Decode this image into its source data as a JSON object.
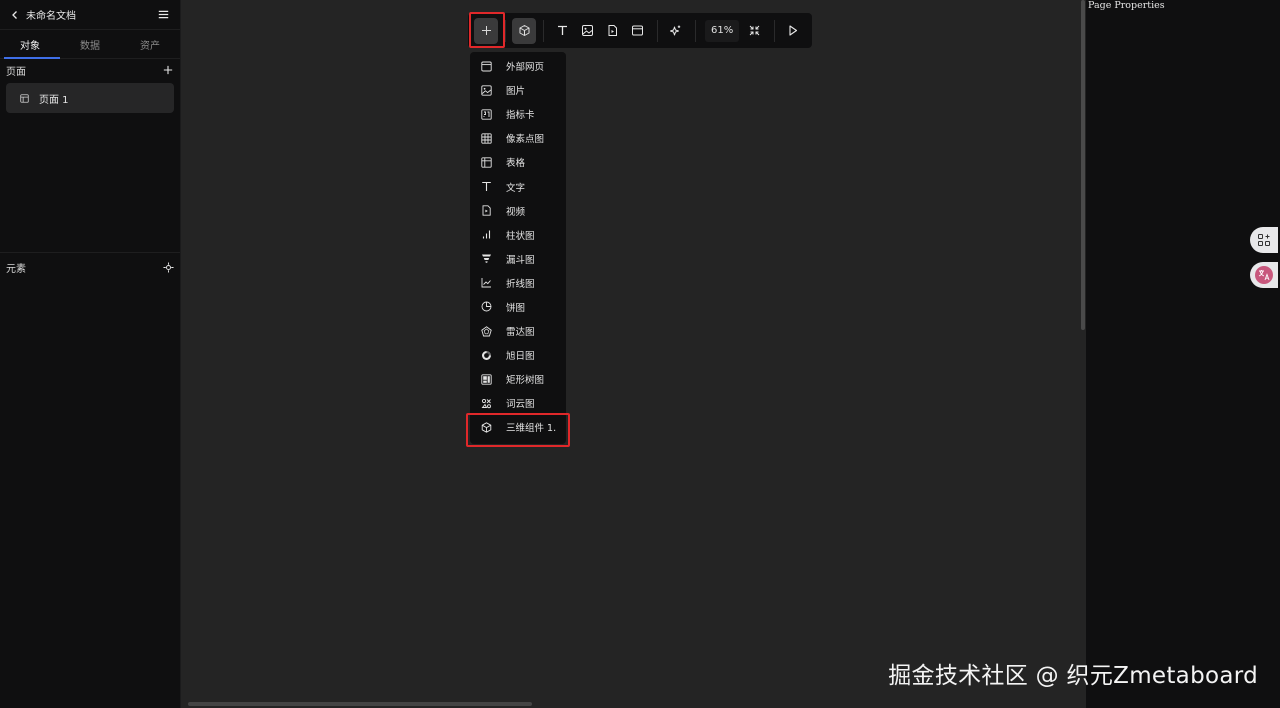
{
  "sidebar": {
    "doc_title": "未命名文档",
    "tabs": [
      {
        "label": "对象",
        "active": true
      },
      {
        "label": "数据",
        "active": false
      },
      {
        "label": "资产",
        "active": false
      }
    ],
    "pages_section": "页面",
    "pages": [
      {
        "label": "页面 1"
      }
    ],
    "elements_section": "元素"
  },
  "toolbar": {
    "zoom": "61%"
  },
  "dropdown": {
    "items": [
      {
        "label": "外部网页",
        "icon": "browser-window-icon"
      },
      {
        "label": "图片",
        "icon": "image-icon"
      },
      {
        "label": "指标卡",
        "icon": "metric-card-icon"
      },
      {
        "label": "像素点图",
        "icon": "grid-icon"
      },
      {
        "label": "表格",
        "icon": "table-icon"
      },
      {
        "label": "文字",
        "icon": "text-icon"
      },
      {
        "label": "视频",
        "icon": "video-icon"
      },
      {
        "label": "柱状图",
        "icon": "bar-chart-icon"
      },
      {
        "label": "漏斗图",
        "icon": "funnel-icon"
      },
      {
        "label": "折线图",
        "icon": "line-chart-icon"
      },
      {
        "label": "饼图",
        "icon": "pie-chart-icon"
      },
      {
        "label": "雷达图",
        "icon": "radar-icon"
      },
      {
        "label": "旭日图",
        "icon": "sunburst-icon"
      },
      {
        "label": "矩形树图",
        "icon": "treemap-icon"
      },
      {
        "label": "词云图",
        "icon": "word-cloud-icon"
      },
      {
        "label": "三维组件 1.",
        "icon": "cube-icon"
      }
    ]
  },
  "right_panel": {
    "title": "Page Properties"
  },
  "watermark": "掘金技术社区 @ 织元Zmetaboard",
  "colors": {
    "accent": "#3f6fe8",
    "highlight": "#e0282a",
    "panel_bg": "#0f0f10",
    "canvas_bg": "#242424"
  }
}
